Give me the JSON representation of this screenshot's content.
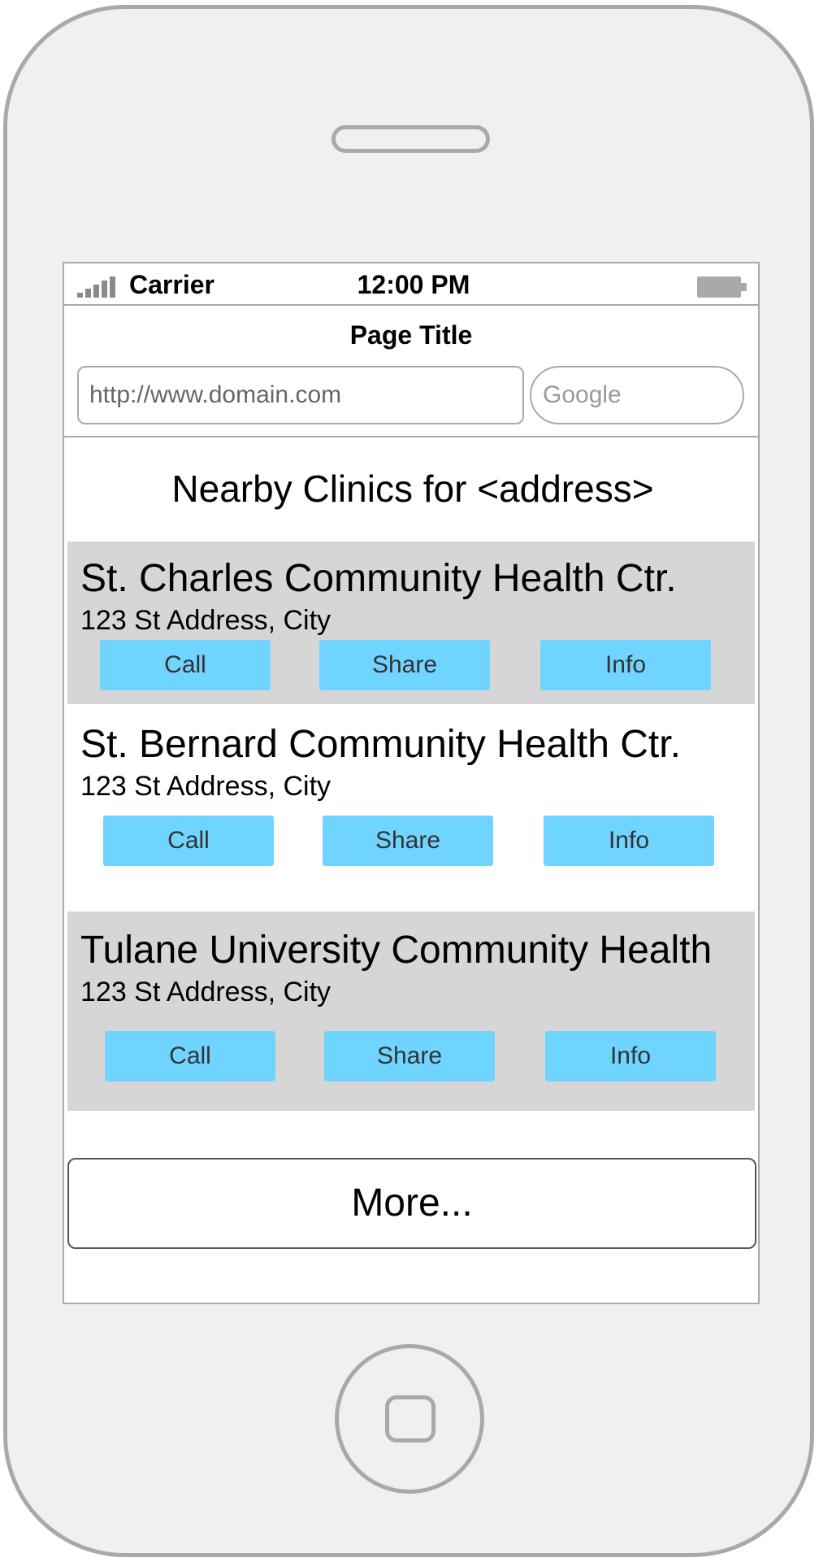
{
  "status_bar": {
    "carrier": "Carrier",
    "time": "12:00 PM",
    "signal_icon": "signal-bars-icon",
    "battery_icon": "battery-icon"
  },
  "browser": {
    "page_title": "Page Title",
    "url_placeholder": "http://www.domain.com",
    "search_placeholder": "Google"
  },
  "main": {
    "heading": "Nearby Clinics for <address>",
    "clinics": [
      {
        "name": "St. Charles Community Health Ctr.",
        "address": "123 St Address, City",
        "call_label": "Call",
        "share_label": "Share",
        "info_label": "Info",
        "background": "#d6d6d6"
      },
      {
        "name": "St. Bernard Community Health Ctr.",
        "address": "123 St Address, City",
        "call_label": "Call",
        "share_label": "Share",
        "info_label": "Info",
        "background": "#ffffff"
      },
      {
        "name": "Tulane University Community Health",
        "address": "123 St Address, City",
        "call_label": "Call",
        "share_label": "Share",
        "info_label": "Info",
        "background": "#d6d6d6"
      }
    ],
    "more_label": "More..."
  },
  "colors": {
    "button_accent": "#6fd4ff",
    "frame": "#a9a9a9",
    "phone_body": "#f0f0f0"
  }
}
